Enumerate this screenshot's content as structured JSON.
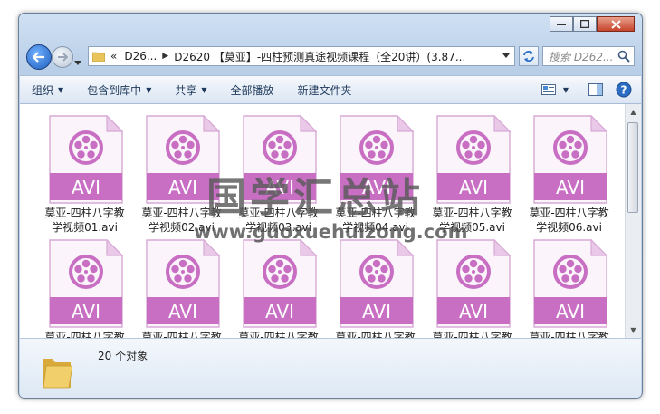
{
  "window": {
    "breadcrumb": {
      "chevrons": "«",
      "crumb1": "D26...",
      "crumb2": "D2620 【莫亚】-四柱预测真途视频课程（全20讲）(3.87..."
    },
    "search_placeholder": "搜索 D262..."
  },
  "toolbar": {
    "organize": "组织",
    "include_library": "包含到库中",
    "share": "共享",
    "play_all": "全部播放",
    "new_folder": "新建文件夹",
    "dropdown_arrow": "▼"
  },
  "file_type_label": "AVI",
  "files": [
    {
      "line1": "莫亚-四柱八字教",
      "line2": "学视频01.avi"
    },
    {
      "line1": "莫亚-四柱八字教",
      "line2": "学视频02.avi"
    },
    {
      "line1": "莫亚-四柱八字教",
      "line2": "学视频03.avi"
    },
    {
      "line1": "莫亚-四柱八字教",
      "line2": "学视频04.avi"
    },
    {
      "line1": "莫亚-四柱八字教",
      "line2": "学视频05.avi"
    },
    {
      "line1": "莫亚-四柱八字教",
      "line2": "学视频06.avi"
    },
    {
      "line1": "莫亚-四柱八字教",
      "line2": ""
    },
    {
      "line1": "莫亚-四柱八字教",
      "line2": ""
    },
    {
      "line1": "莫亚-四柱八字教",
      "line2": ""
    },
    {
      "line1": "莫亚-四柱八字教",
      "line2": ""
    },
    {
      "line1": "莫亚-四柱八字教",
      "line2": ""
    },
    {
      "line1": "莫亚-四柱八字教",
      "line2": ""
    }
  ],
  "details": {
    "count": "20 个对象"
  },
  "watermark": {
    "title": "国学汇总站",
    "url": "www.guoxuehuizong.com"
  },
  "colors": {
    "avi_band": "#c86fc4",
    "film_reel": "#c86fc4",
    "folder": "#e8c45a"
  },
  "icons": {
    "back": "arrow-left-icon",
    "forward": "arrow-right-icon",
    "refresh": "refresh-icon",
    "search": "magnifier-icon",
    "file": "avi-video-file-icon",
    "folder": "folder-icon",
    "view": "view-options-icon",
    "preview": "preview-pane-icon",
    "help": "help-icon"
  }
}
